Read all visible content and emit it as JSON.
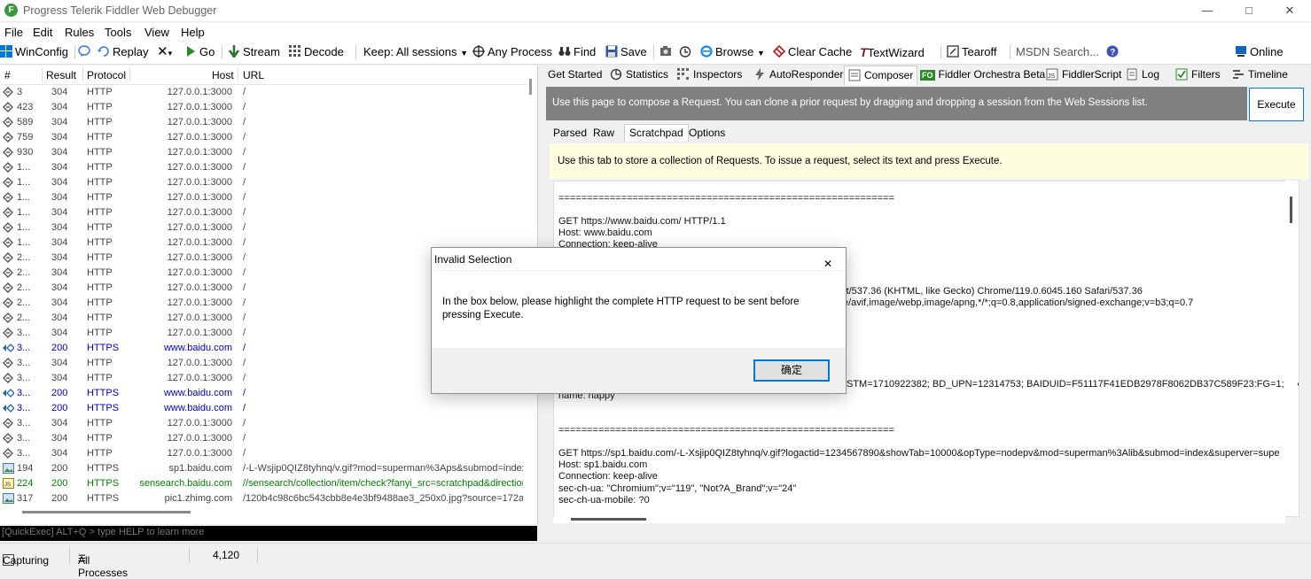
{
  "window": {
    "title": "Progress Telerik Fiddler Web Debugger"
  },
  "menu": [
    "File",
    "Edit",
    "Rules",
    "Tools",
    "View",
    "Help"
  ],
  "toolbar": {
    "winconfig": "WinConfig",
    "replay": "Replay",
    "go": "Go",
    "stream": "Stream",
    "decode": "Decode",
    "keep": "Keep: All sessions",
    "any_process": "Any Process",
    "find": "Find",
    "save": "Save",
    "browse": "Browse",
    "clear_cache": "Clear Cache",
    "textwizard": "TextWizard",
    "tearoff": "Tearoff",
    "msdn_search": "MSDN Search...",
    "online": "Online"
  },
  "sessions": {
    "columns": [
      "#",
      "Result",
      "Protocol",
      "Host",
      "URL"
    ],
    "rows": [
      {
        "id": "3",
        "result": "304",
        "protocol": "HTTP",
        "host": "127.0.0.1:3000",
        "url": "/",
        "kind": "normal"
      },
      {
        "id": "423",
        "result": "304",
        "protocol": "HTTP",
        "host": "127.0.0.1:3000",
        "url": "/",
        "kind": "normal"
      },
      {
        "id": "589",
        "result": "304",
        "protocol": "HTTP",
        "host": "127.0.0.1:3000",
        "url": "/",
        "kind": "normal"
      },
      {
        "id": "759",
        "result": "304",
        "protocol": "HTTP",
        "host": "127.0.0.1:3000",
        "url": "/",
        "kind": "normal"
      },
      {
        "id": "930",
        "result": "304",
        "protocol": "HTTP",
        "host": "127.0.0.1:3000",
        "url": "/",
        "kind": "normal"
      },
      {
        "id": "1...",
        "result": "304",
        "protocol": "HTTP",
        "host": "127.0.0.1:3000",
        "url": "/",
        "kind": "normal"
      },
      {
        "id": "1...",
        "result": "304",
        "protocol": "HTTP",
        "host": "127.0.0.1:3000",
        "url": "/",
        "kind": "normal"
      },
      {
        "id": "1...",
        "result": "304",
        "protocol": "HTTP",
        "host": "127.0.0.1:3000",
        "url": "/",
        "kind": "normal"
      },
      {
        "id": "1...",
        "result": "304",
        "protocol": "HTTP",
        "host": "127.0.0.1:3000",
        "url": "/",
        "kind": "normal"
      },
      {
        "id": "1...",
        "result": "304",
        "protocol": "HTTP",
        "host": "127.0.0.1:3000",
        "url": "/",
        "kind": "normal"
      },
      {
        "id": "1...",
        "result": "304",
        "protocol": "HTTP",
        "host": "127.0.0.1:3000",
        "url": "/",
        "kind": "normal"
      },
      {
        "id": "2...",
        "result": "304",
        "protocol": "HTTP",
        "host": "127.0.0.1:3000",
        "url": "/",
        "kind": "normal"
      },
      {
        "id": "2...",
        "result": "304",
        "protocol": "HTTP",
        "host": "127.0.0.1:3000",
        "url": "/",
        "kind": "normal"
      },
      {
        "id": "2...",
        "result": "304",
        "protocol": "HTTP",
        "host": "127.0.0.1:3000",
        "url": "/",
        "kind": "normal"
      },
      {
        "id": "2...",
        "result": "304",
        "protocol": "HTTP",
        "host": "127.0.0.1:3000",
        "url": "/",
        "kind": "normal"
      },
      {
        "id": "2...",
        "result": "304",
        "protocol": "HTTP",
        "host": "127.0.0.1:3000",
        "url": "/",
        "kind": "normal"
      },
      {
        "id": "3...",
        "result": "304",
        "protocol": "HTTP",
        "host": "127.0.0.1:3000",
        "url": "/",
        "kind": "normal"
      },
      {
        "id": "3...",
        "result": "200",
        "protocol": "HTTPS",
        "host": "www.baidu.com",
        "url": "/",
        "kind": "blue"
      },
      {
        "id": "3...",
        "result": "304",
        "protocol": "HTTP",
        "host": "127.0.0.1:3000",
        "url": "/",
        "kind": "normal"
      },
      {
        "id": "3...",
        "result": "304",
        "protocol": "HTTP",
        "host": "127.0.0.1:3000",
        "url": "/",
        "kind": "normal"
      },
      {
        "id": "3...",
        "result": "200",
        "protocol": "HTTPS",
        "host": "www.baidu.com",
        "url": "/",
        "kind": "blue"
      },
      {
        "id": "3...",
        "result": "200",
        "protocol": "HTTPS",
        "host": "www.baidu.com",
        "url": "/",
        "kind": "blue"
      },
      {
        "id": "3...",
        "result": "304",
        "protocol": "HTTP",
        "host": "127.0.0.1:3000",
        "url": "/",
        "kind": "normal"
      },
      {
        "id": "3...",
        "result": "304",
        "protocol": "HTTP",
        "host": "127.0.0.1:3000",
        "url": "/",
        "kind": "normal"
      },
      {
        "id": "3...",
        "result": "304",
        "protocol": "HTTP",
        "host": "127.0.0.1:3000",
        "url": "/",
        "kind": "normal"
      },
      {
        "id": "194",
        "result": "200",
        "protocol": "HTTPS",
        "host": "sp1.baidu.com",
        "url": "/-L-Wsjip0QIZ8tyhnq/v.gif?mod=superman%3Aps&submod=index",
        "kind": "image"
      },
      {
        "id": "224",
        "result": "200",
        "protocol": "HTTPS",
        "host": "sensearch.baidu.com",
        "url": "//sensearch/collection/item/check?fanyi_src=scratchpad&direction",
        "kind": "green"
      },
      {
        "id": "317",
        "result": "200",
        "protocol": "HTTPS",
        "host": "pic1.zhimg.com",
        "url": "/120b4c98c6bc543cbb8e4e3bf9488ae3_250x0.jpg?source=172ae",
        "kind": "image"
      }
    ]
  },
  "quickexec": {
    "placeholder": "[QuickExec] ALT+Q > type HELP to learn more"
  },
  "right_tabs": [
    "Get Started",
    "Statistics",
    "Inspectors",
    "AutoResponder",
    "Composer",
    "Fiddler Orchestra Beta",
    "FiddlerScript",
    "Log",
    "Filters",
    "Timeline"
  ],
  "composer": {
    "banner": "Use this page to compose a Request. You can clone a prior request by dragging and dropping a session from the Web Sessions list.",
    "execute": "Execute",
    "subtabs": [
      "Parsed",
      "Raw",
      "Scratchpad",
      "Options"
    ],
    "info": "Use this tab to store a collection of Requests. To issue a request, select its text and press Execute.",
    "lines": [
      "===========================================================",
      "",
      "GET https://www.baidu.com/ HTTP/1.1",
      "Host: www.baidu.com",
      "Connection: keep-alive",
      "",
      "",
      "",
      "                                                                                                       Kit/537.36 (KHTML, like Gecko) Chrome/119.0.6045.160 Safari/537.36",
      "                                                                                                       ge/avif,image/webp,image/apng,*/*;q=0.8,application/signed-exchange;v=b3;q=0.7",
      "",
      "",
      "",
      "",
      "",
      "",
      "Cookie: BIDUPSID=BFE1BD4CE367BFE367315A74976E2EFA; PSTM=1710922382; BD_UPN=12314753; BAIDUID=F51117F41EDB2978F8062DB37C589F23:FG=1; BAIDU",
      "name: happy",
      "",
      "",
      "===========================================================",
      "",
      "GET https://sp1.baidu.com/-L-Xsjip0QIZ8tyhnq/v.gif?logactid=1234567890&showTab=10000&opType=nodepv&mod=superman%3Alib&submod=index&superver=supe",
      "Host: sp1.baidu.com",
      "Connection: keep-alive",
      "sec-ch-ua: \"Chromium\";v=\"119\", \"Not?A_Brand\";v=\"24\"",
      "sec-ch-ua-mobile: ?0"
    ]
  },
  "status": {
    "capturing": "Capturing",
    "processes": "All Processes",
    "count": "4,120"
  },
  "dialog": {
    "title": "Invalid Selection",
    "message": "In the box below, please highlight the complete HTTP request to be sent before pressing Execute.",
    "ok": "确定"
  }
}
